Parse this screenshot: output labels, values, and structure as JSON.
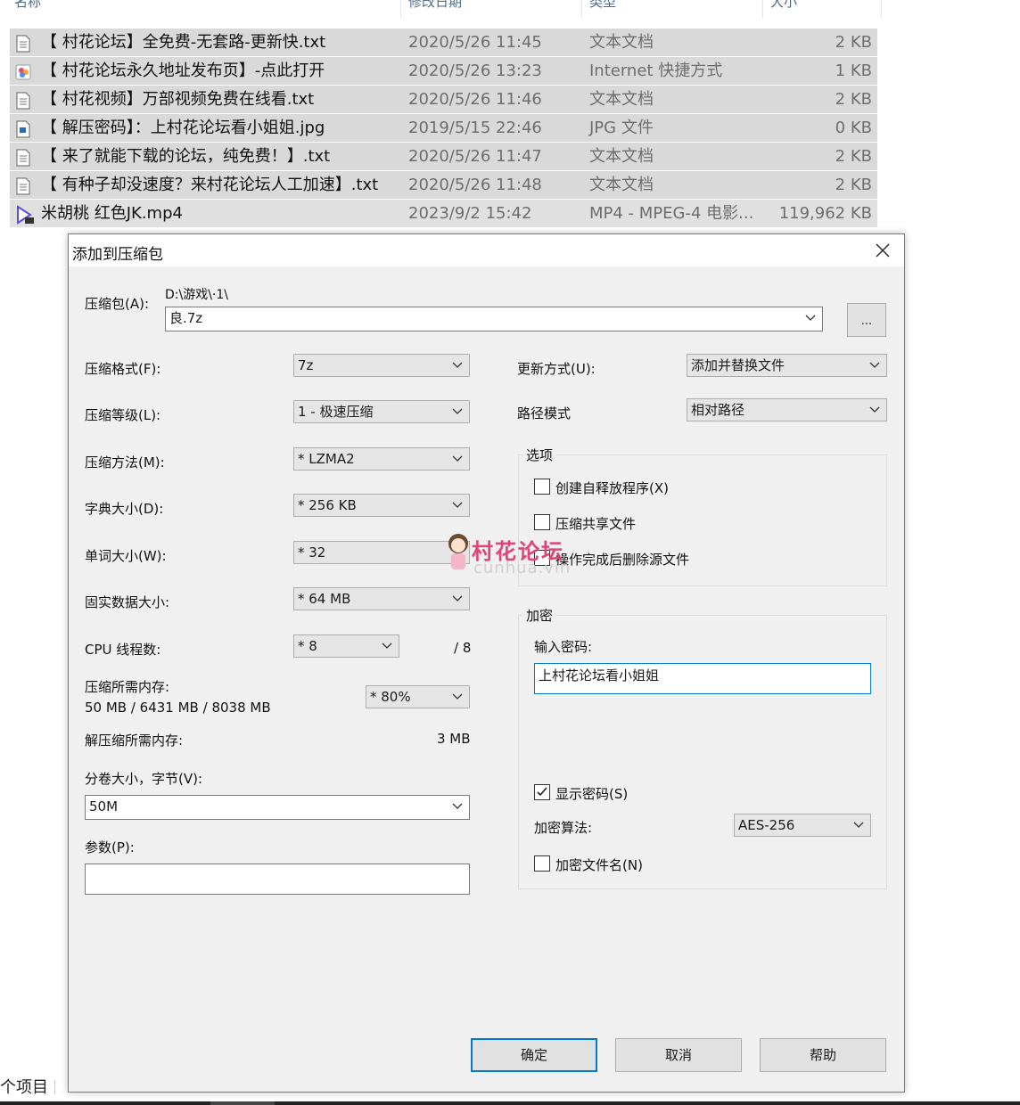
{
  "explorer": {
    "columns": [
      "名称",
      "修改日期",
      "类型",
      "大小"
    ],
    "files": [
      {
        "name": "【 村花论坛】全免费-无套路-更新快.txt",
        "date": "2020/5/26 11:45",
        "type": "文本文档",
        "size": "2 KB",
        "icon": "text-file-icon"
      },
      {
        "name": "【 村花论坛永久地址发布页】-点此打开",
        "date": "2020/5/26 13:23",
        "type": "Internet 快捷方式",
        "size": "1 KB",
        "icon": "internet-shortcut-icon"
      },
      {
        "name": "【 村花视频】万部视频免费在线看.txt",
        "date": "2020/5/26 11:46",
        "type": "文本文档",
        "size": "2 KB",
        "icon": "text-file-icon"
      },
      {
        "name": "【 解压密码】：上村花论坛看小姐姐.jpg",
        "date": "2019/5/15 22:46",
        "type": "JPG 文件",
        "size": "0 KB",
        "icon": "image-file-icon"
      },
      {
        "name": "【 来了就能下载的论坛，纯免费！】.txt",
        "date": "2020/5/26 11:47",
        "type": "文本文档",
        "size": "2 KB",
        "icon": "text-file-icon"
      },
      {
        "name": "【 有种子却没速度？来村花论坛人工加速】.txt",
        "date": "2020/5/26 11:48",
        "type": "文本文档",
        "size": "2 KB",
        "icon": "text-file-icon"
      },
      {
        "name": "米胡桃  红色JK.mp4",
        "date": "2023/9/2 15:42",
        "type": "MP4 - MPEG-4 电影...",
        "size": "119,962 KB",
        "icon": "video-file-icon"
      }
    ],
    "status": "个项目"
  },
  "dialog": {
    "title": "添加到压缩包",
    "archive_label": "压缩包(A):",
    "archive_path": "D:\\游戏\\·1\\",
    "archive_name": "良.7z",
    "browse_label": "...",
    "format_label": "压缩格式(F):",
    "format_value": "7z",
    "level_label": "压缩等级(L):",
    "level_value": "1 - 极速压缩",
    "method_label": "压缩方法(M):",
    "method_value": "* LZMA2",
    "dict_label": "字典大小(D):",
    "dict_value": "* 256 KB",
    "word_label": "单词大小(W):",
    "word_value": "* 32",
    "solid_label": "固实数据大小:",
    "solid_value": "* 64 MB",
    "cpu_label": "CPU 线程数:",
    "cpu_value": "* 8",
    "cpu_total": "/ 8",
    "mem_label": "压缩所需内存:",
    "mem_value": "50 MB / 6431 MB / 8038 MB",
    "mem_percent": "* 80%",
    "decomp_label": "解压缩所需内存:",
    "decomp_value": "3 MB",
    "volume_label": "分卷大小，字节(V):",
    "volume_value": "50M",
    "params_label": "参数(P):",
    "params_value": "",
    "update_label": "更新方式(U):",
    "update_value": "添加并替换文件",
    "path_label": "路径模式",
    "path_value": "相对路径",
    "options_title": "选项",
    "opt_sfx": "创建自释放程序(X)",
    "opt_shared": "压缩共享文件",
    "opt_delete": "操作完成后删除源文件",
    "encryption_title": "加密",
    "password_label": "输入密码:",
    "password_value": "上村花论坛看小姐姐",
    "show_password": "显示密码(S)",
    "show_password_checked": true,
    "algo_label": "加密算法:",
    "algo_value": "AES-256",
    "encrypt_names": "加密文件名(N)",
    "ok": "确定",
    "cancel": "取消",
    "help": "帮助"
  },
  "watermark": {
    "text": "村花论坛",
    "sub": "cunhua.vin"
  }
}
